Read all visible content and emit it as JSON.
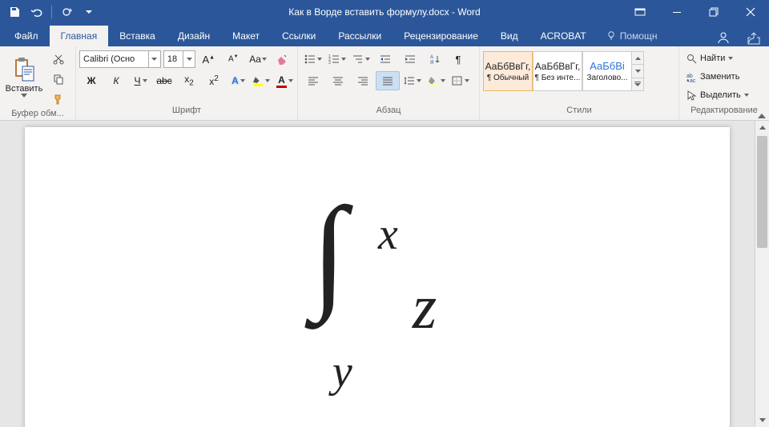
{
  "title": "Как в Ворде вставить формулу.docx - Word",
  "tabs": {
    "file": "Файл",
    "home": "Главная",
    "insert": "Вставка",
    "design": "Дизайн",
    "layout": "Макет",
    "references": "Ссылки",
    "mailings": "Рассылки",
    "review": "Рецензирование",
    "view": "Вид",
    "acrobat": "ACROBAT"
  },
  "tellme": "Помощн",
  "clipboard": {
    "paste": "Вставить",
    "label": "Буфер обм..."
  },
  "font": {
    "name": "Calibri (Осно",
    "size": "18",
    "label": "Шрифт"
  },
  "para": {
    "label": "Абзац"
  },
  "styles": {
    "label": "Стили",
    "preview": "АаБбВвГг,",
    "preview_heading": "АаБбВі",
    "s1": "¶ Обычный",
    "s2": "¶ Без инте...",
    "s3": "Заголово..."
  },
  "editing": {
    "find": "Найти",
    "replace": "Заменить",
    "select": "Выделить",
    "label": "Редактирование"
  },
  "formula": {
    "upper": "x",
    "lower": "y",
    "integrand": "z"
  }
}
